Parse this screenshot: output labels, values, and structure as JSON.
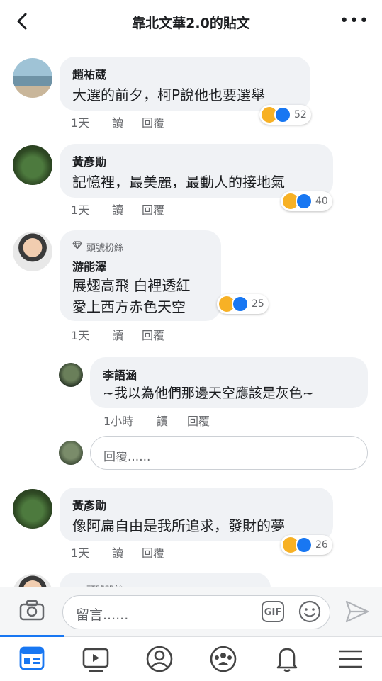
{
  "header": {
    "title": "靠北文華2.0的貼文"
  },
  "comments": [
    {
      "name": "趙祐葳",
      "lines": [
        "大選的前夕，柯P說他也要選舉"
      ],
      "reactions": "52",
      "meta": {
        "time": "1天",
        "read": "讀",
        "reply": "回覆"
      }
    },
    {
      "name": "黃彥勛",
      "lines": [
        "記憶裡，最美麗，最動人的接地氣"
      ],
      "reactions": "40",
      "meta": {
        "time": "1天",
        "read": "讀",
        "reply": "回覆"
      }
    },
    {
      "badge": "頭號粉絲",
      "name": "游能澤",
      "lines": [
        "展翅高飛 白裡透紅",
        "愛上西方赤色天空"
      ],
      "reactions": "25",
      "meta": {
        "time": "1天",
        "read": "讀",
        "reply": "回覆"
      }
    },
    {
      "name": "黃彥勛",
      "lines": [
        "像阿扁自由是我所追求，發財的夢"
      ],
      "reactions": "26",
      "meta": {
        "time": "1天",
        "read": "讀",
        "reply": "回覆"
      }
    },
    {
      "badge": "頭號粉絲"
    }
  ],
  "reply": {
    "name": "李語涵",
    "text": "~我以為他們那邊天空應該是灰色~",
    "meta": {
      "time": "1小時",
      "read": "讀",
      "reply": "回覆"
    }
  },
  "reply_input": {
    "placeholder": "回覆......"
  },
  "composer": {
    "placeholder": "留言......",
    "gif": "GIF"
  },
  "icons": {
    "back": "back-arrow-icon",
    "more": "more-dots-icon",
    "camera": "camera-icon",
    "emoji": "smiley-icon",
    "send": "send-icon",
    "haha": "haha-reaction-icon",
    "like": "like-reaction-icon",
    "tabs": [
      "news-feed-icon",
      "watch-icon",
      "profile-icon",
      "groups-icon",
      "bell-icon",
      "menu-icon"
    ]
  },
  "colors": {
    "accent": "#1877f2",
    "bubble": "#f0f2f5",
    "haha": "#f7b125"
  }
}
